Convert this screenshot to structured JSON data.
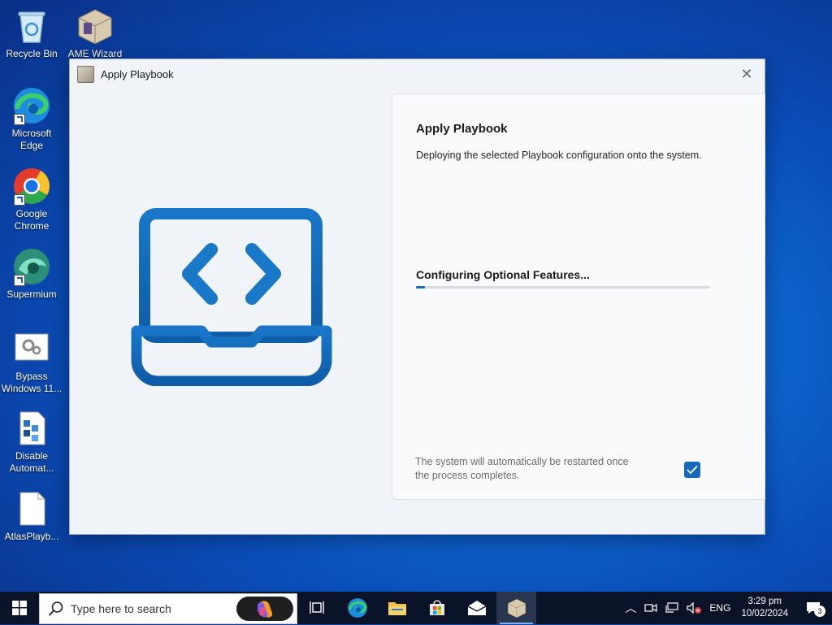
{
  "desktop": {
    "icons": [
      {
        "label": "Recycle Bin"
      },
      {
        "label": "AME Wizard"
      },
      {
        "label": "Microsoft Edge"
      },
      {
        "label": "Google Chrome"
      },
      {
        "label": "Supermium"
      },
      {
        "label": "Bypass Windows 11..."
      },
      {
        "label": "Disable Automat..."
      },
      {
        "label": "AtlasPlayb..."
      }
    ]
  },
  "window": {
    "title": "Apply Playbook",
    "close_icon": "close-icon",
    "heading": "Apply Playbook",
    "description": "Deploying the selected Playbook configuration onto the system.",
    "status": "Configuring Optional Features...",
    "progress": 0.03,
    "restart_note": "The system will automatically be restarted once the process completes.",
    "restart_checked": true,
    "accent_color": "#1668b8"
  },
  "taskbar": {
    "search_placeholder": "Type here to search",
    "pinned": [
      "task-view-icon",
      "edge-icon",
      "file-explorer-icon",
      "store-icon",
      "mail-icon",
      "ame-wizard-icon"
    ],
    "tray": {
      "language": "ENG",
      "time": "3:29 pm",
      "date": "10/02/2024",
      "notification_count": "3"
    }
  }
}
